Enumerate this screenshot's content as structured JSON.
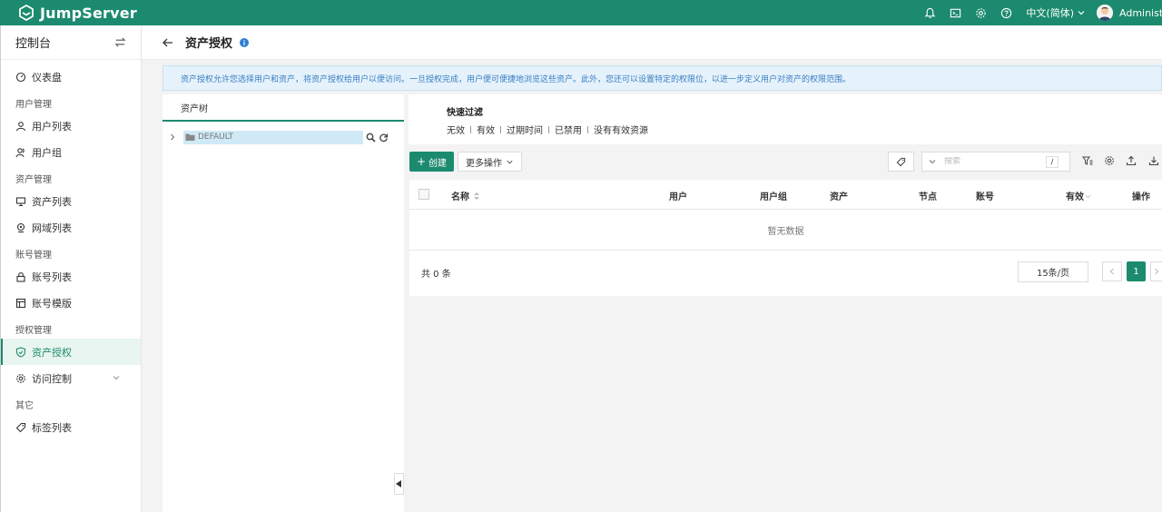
{
  "app": {
    "name": "JumpServer"
  },
  "topbar": {
    "language": "中文(简体)",
    "user": "Administrator"
  },
  "sidebar": {
    "title": "控制台",
    "items": [
      {
        "label": "仪表盘",
        "icon": "dashboard-icon"
      },
      {
        "group": "用户管理"
      },
      {
        "label": "用户列表",
        "icon": "user-icon"
      },
      {
        "label": "用户组",
        "icon": "users-icon"
      },
      {
        "group": "资产管理"
      },
      {
        "label": "资产列表",
        "icon": "monitor-icon"
      },
      {
        "label": "网域列表",
        "icon": "location-icon"
      },
      {
        "group": "账号管理"
      },
      {
        "label": "账号列表",
        "icon": "lock-icon"
      },
      {
        "label": "账号模版",
        "icon": "template-icon"
      },
      {
        "group": "授权管理"
      },
      {
        "label": "资产授权",
        "icon": "shield-icon",
        "active": true
      },
      {
        "label": "访问控制",
        "icon": "gear-icon",
        "expandable": true
      },
      {
        "group": "其它"
      },
      {
        "label": "标签列表",
        "icon": "tag-icon"
      }
    ]
  },
  "header": {
    "title": "资产授权"
  },
  "notice": "资产授权允许您选择用户和资产，将资产授权给用户以便访问。一旦授权完成，用户便可便捷地浏览这些资产。此外，您还可以设置特定的权限位，以进一步定义用户对资产的权限范围。",
  "tree": {
    "tab": "资产树",
    "root": "DEFAULT"
  },
  "filter": {
    "title": "快速过滤",
    "options": [
      "无效",
      "有效",
      "过期时间",
      "已禁用",
      "没有有效资源"
    ]
  },
  "toolbar": {
    "create": "创建",
    "more": "更多操作",
    "search_placeholder": "搜索",
    "shortcut": "/"
  },
  "table": {
    "columns": [
      "名称",
      "用户",
      "用户组",
      "资产",
      "节点",
      "账号",
      "有效",
      "操作"
    ],
    "empty": "暂无数据",
    "total": "共 0 条",
    "page_size": "15条/页",
    "current_page": "1"
  },
  "colors": {
    "primary": "#1c8a6e",
    "notice_bg": "#e6f2fb",
    "notice_text": "#3a7ec2"
  }
}
